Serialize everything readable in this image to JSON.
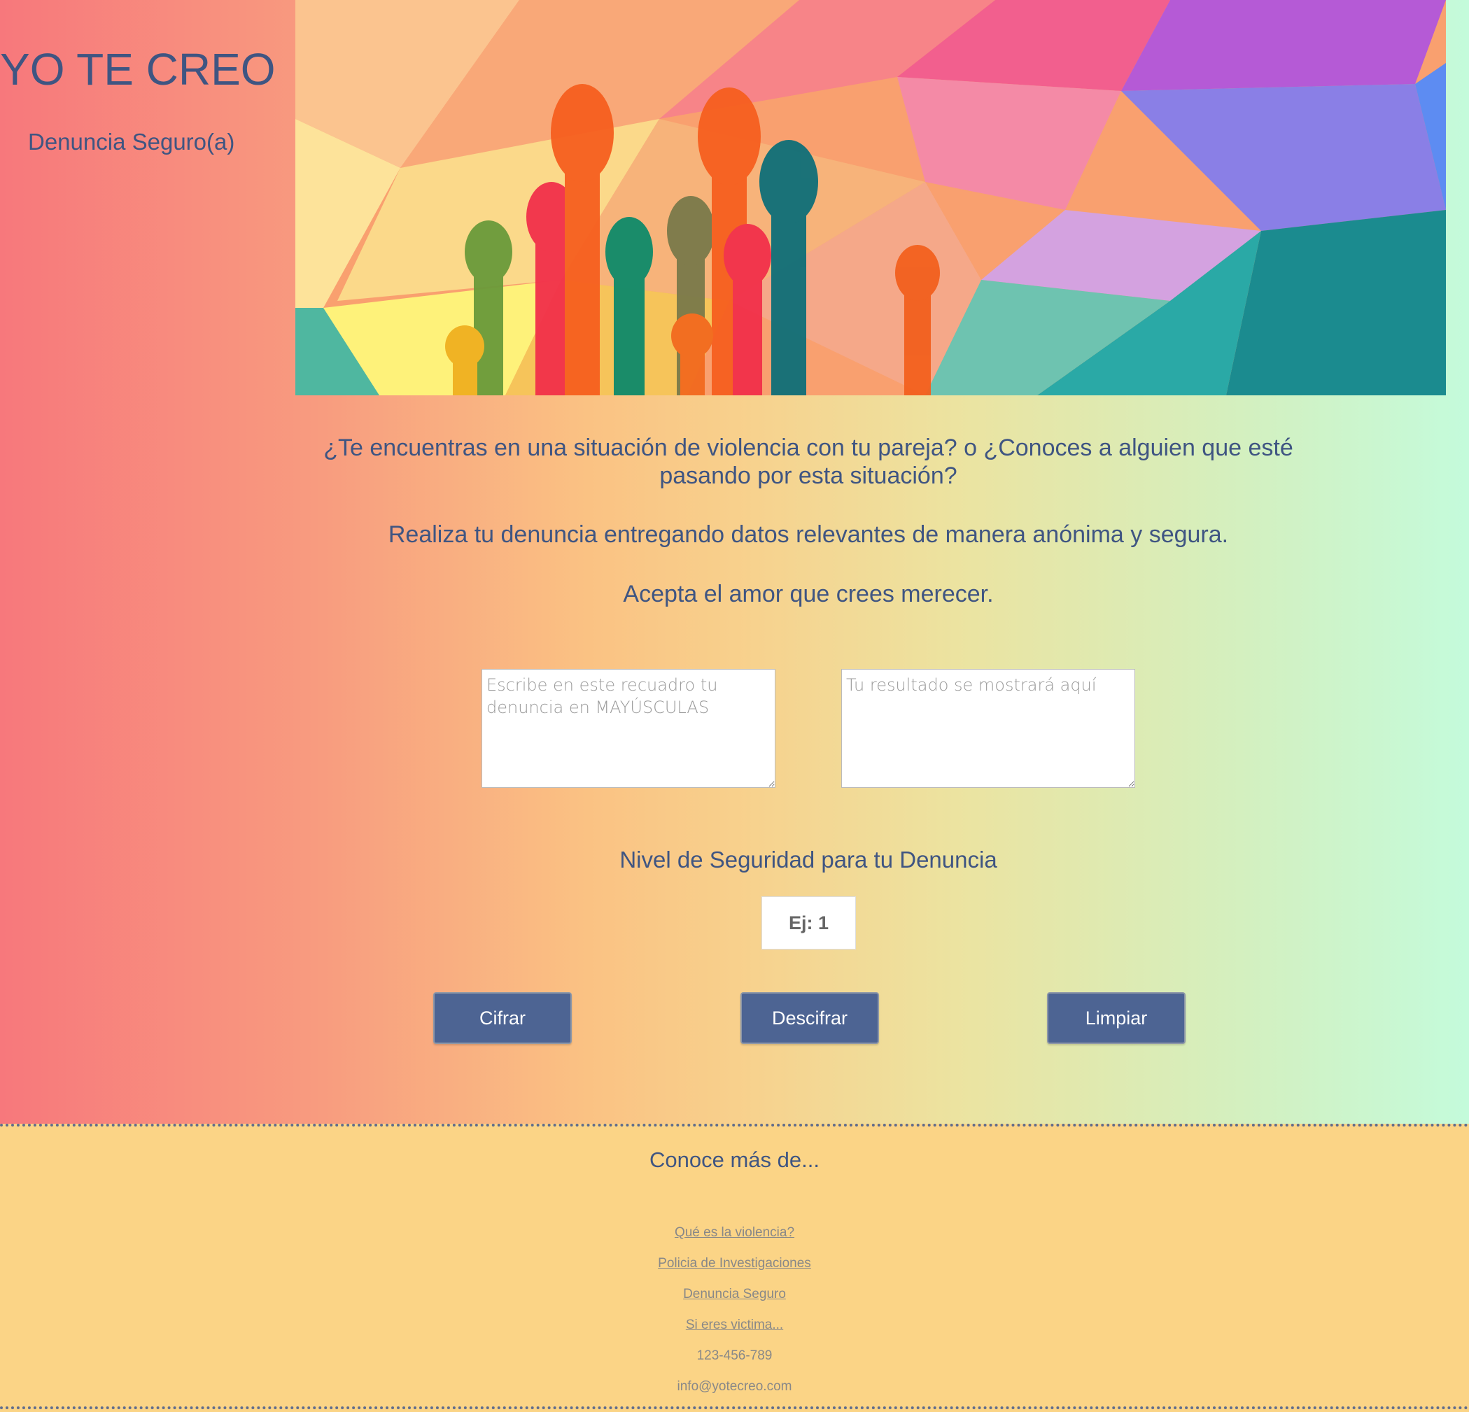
{
  "brand": {
    "title": "YO TE CREO",
    "subtitle": "Denuncia Seguro(a)"
  },
  "hero": {
    "image": "raised-hands-colorful-polygon-banner"
  },
  "intro": {
    "question": "¿Te encuentras en una situación de violencia con tu pareja? o ¿Conoces a alguien que esté pasando por esta situación?",
    "report": "Realiza tu denuncia entregando datos relevantes de manera anónima y segura.",
    "accept": "Acepta el amor que crees merecer."
  },
  "form": {
    "input_placeholder": "Escribe en este recuadro tu denuncia en MAYÚSCULAS",
    "output_placeholder": "Tu resultado se mostrará aquí",
    "level_label": "Nivel de Seguridad para tu Denuncia",
    "level_placeholder": "Ej: 1",
    "buttons": {
      "encrypt": "Cifrar",
      "decrypt": "Descifrar",
      "clear": "Limpiar"
    }
  },
  "footer": {
    "title": "Conoce más de...",
    "links": [
      "Qué es la violencia?",
      "Policia de Investigaciones",
      "Denuncia Seguro",
      "Si eres victima..."
    ],
    "phone": "123-456-789",
    "email": "info@yotecreo.com"
  },
  "colors": {
    "text": "#3f5582",
    "button": "#4d6493",
    "footer_bg": "#fbd486"
  }
}
